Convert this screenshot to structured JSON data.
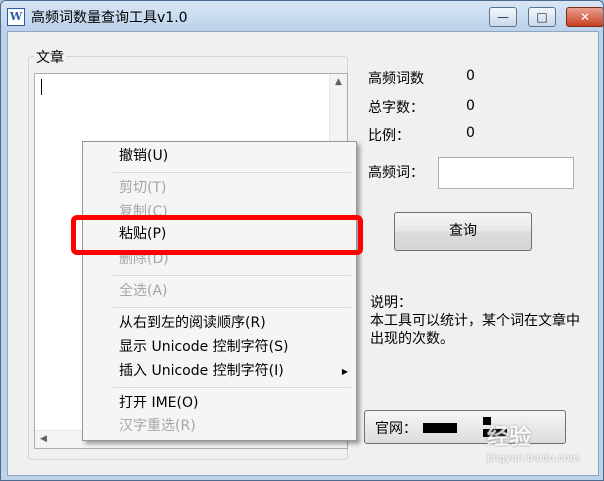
{
  "window": {
    "title": "高频词数量查询工具v1.0",
    "icon": "W",
    "buttons": {
      "minimize": "—",
      "maximize": "□",
      "close": "✕"
    }
  },
  "article": {
    "group_label": "文章",
    "text": ""
  },
  "stats": {
    "high_freq_label": "高频词数",
    "high_freq_value": "0",
    "total_label": "总字数：",
    "total_value": "0",
    "ratio_label": "比例：",
    "ratio_value": "0"
  },
  "search": {
    "label": "高频词：",
    "value": "",
    "button": "查询"
  },
  "description": {
    "title": "说明：",
    "body": "本工具可以统计，某个词在文章中出现的次数。"
  },
  "website": {
    "label": "官网："
  },
  "context_menu": [
    {
      "label": "撤销(U)",
      "enabled": true
    },
    {
      "label": "剪切(T)",
      "enabled": false
    },
    {
      "label": "复制(C)",
      "enabled": false
    },
    {
      "label": "粘贴(P)",
      "enabled": true,
      "highlighted": true
    },
    {
      "label": "删除(D)",
      "enabled": false
    },
    {
      "label": "全选(A)",
      "enabled": false
    },
    {
      "label": "从右到左的阅读顺序(R)",
      "enabled": true
    },
    {
      "label": "显示 Unicode 控制字符(S)",
      "enabled": true
    },
    {
      "label": "插入 Unicode 控制字符(I)",
      "enabled": true,
      "submenu": true
    },
    {
      "label": "打开 IME(O)",
      "enabled": true
    },
    {
      "label": "汉字重选(R)",
      "enabled": false
    }
  ],
  "watermark": {
    "text": "经验",
    "url": "jingyan.baidu.com"
  },
  "colors": {
    "highlight_border": "#ff0000",
    "title_bar": "#bcd3ea",
    "disabled_text": "#a6a6a6"
  }
}
